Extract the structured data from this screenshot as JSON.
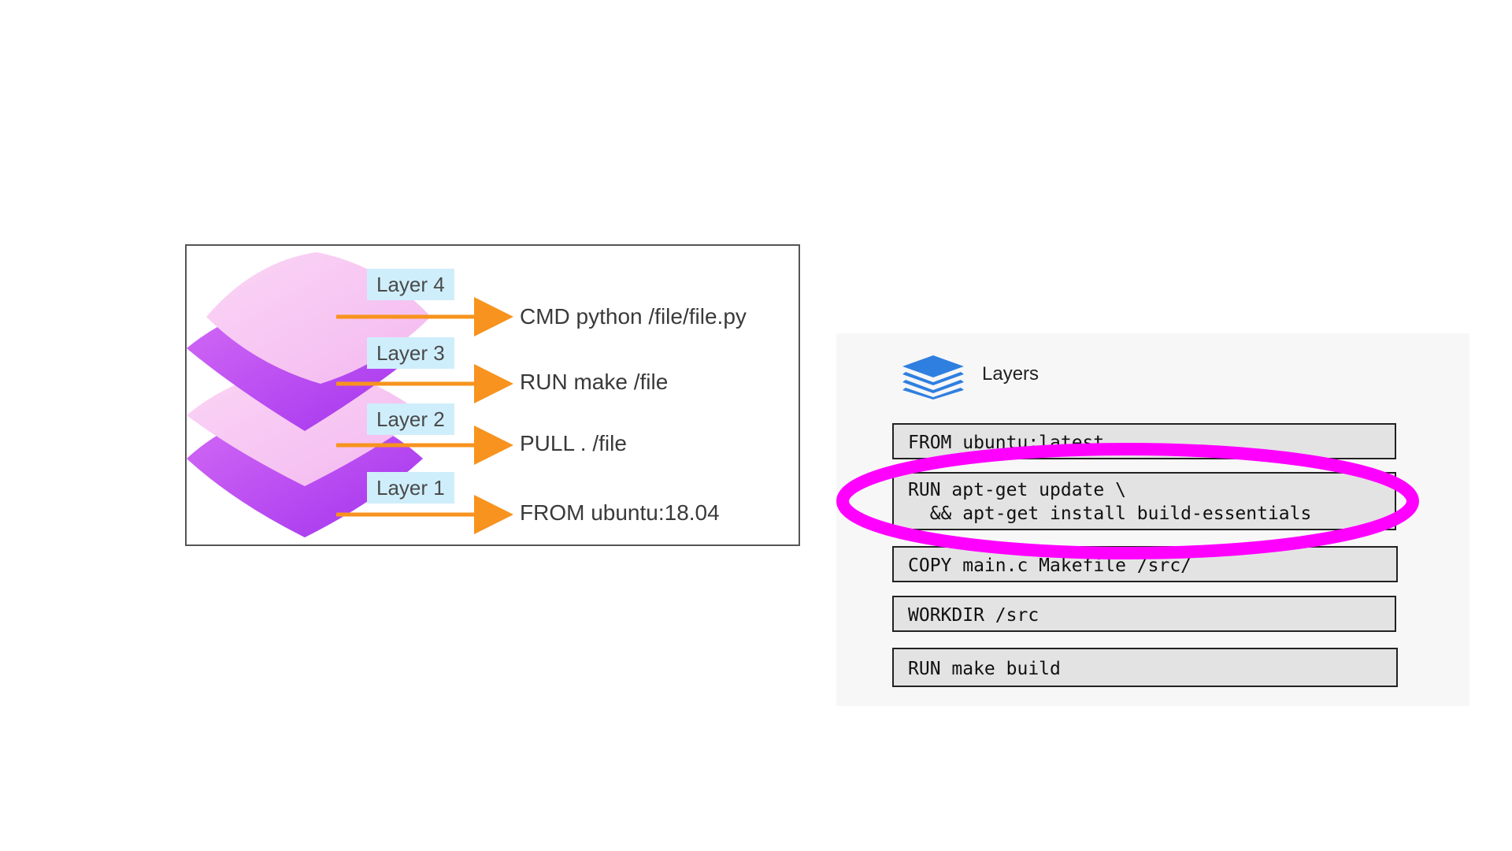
{
  "left_figure": {
    "layers": [
      {
        "tag": "Layer 4",
        "command": "CMD python /file/file.py"
      },
      {
        "tag": "Layer 3",
        "command": "RUN make /file"
      },
      {
        "tag": "Layer 2",
        "command": "PULL . /file"
      },
      {
        "tag": "Layer 1",
        "command": "FROM ubuntu:18.04"
      }
    ],
    "colors": {
      "arrow": "#f7931e",
      "tag_bg": "#cfeefb",
      "layer_light": "#f8c8f5",
      "layer_dark": "#b03ff0"
    }
  },
  "right_figure": {
    "title": "Layers",
    "icon": "layers-stack-icon",
    "dockerfile_lines": [
      "FROM ubuntu:latest",
      "RUN apt-get update \\\n  && apt-get install build-essentials",
      "COPY main.c Makefile /src/",
      "WORKDIR /src",
      "RUN make build"
    ],
    "colors": {
      "icon": "#2f7fe0",
      "highlight": "#ff00ff",
      "box_bg": "#e3e3e3"
    }
  }
}
